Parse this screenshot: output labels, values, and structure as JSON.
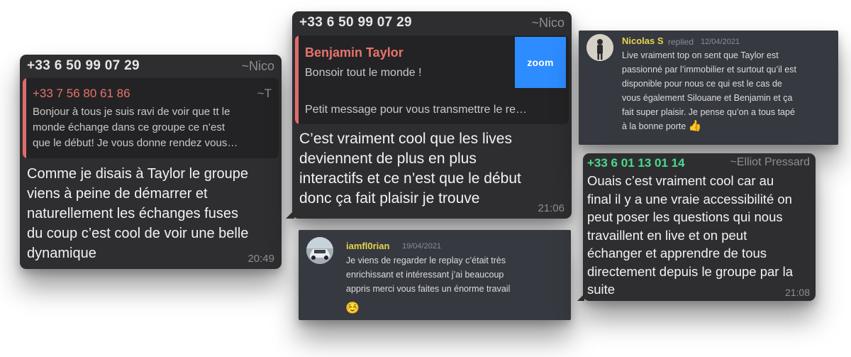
{
  "msg1": {
    "header_phone": "+33 6 50 99 07 29",
    "header_alias": "~Nico",
    "quote_phone": "+33 7 56 80 61 86",
    "quote_alias": "~T",
    "quote_lines": [
      "Bonjour à tous je suis ravi de voir que tt le",
      "monde échange dans ce groupe ce n’est",
      "que le début! Je vous donne rendez vous…"
    ],
    "body_lines": [
      "Comme je disais à Taylor le groupe",
      "viens à peine de démarrer et",
      "naturellement les échanges fuses",
      "du coup c’est cool de voir une belle",
      "dynamique"
    ],
    "time": "20:49"
  },
  "msg2": {
    "header_phone": "+33 6 50 99 07 29",
    "header_alias": "~Nico",
    "quote_name": "Benjamin Taylor",
    "quote_line1": "Bonsoir tout le monde !",
    "quote_line2": "Petit message pour vous transmettre le re…",
    "zoom_label": "zoom",
    "body_lines": [
      "C’est vraiment cool que les lives",
      "deviennent de plus en plus",
      "interactifs et ce n’est que le début",
      "donc ça fait plaisir je trouve"
    ],
    "time": "21:06"
  },
  "msg3": {
    "name": "Nicolas S",
    "action": "replied",
    "date": "12/04/2021",
    "lines": [
      "Live vraiment top on sent que Taylor est",
      "passionné par l’immobilier et surtout qu’il est",
      "disponible pour nous ce qui est le cas de",
      "vous également Silouane et Benjamin et ça",
      "fait super plaisir. Je pense qu’on a tous tapé",
      "à la bonne porte"
    ],
    "emoji": "👍"
  },
  "msg4": {
    "name": "iamfl0rian",
    "date": "19/04/2021",
    "lines": [
      "Je viens de regarder le replay c’était très",
      "enrichissant et intéressant j’ai beaucoup",
      "appris merci vous faites un énorme travail"
    ],
    "emoji": "☺️"
  },
  "msg5": {
    "header_phone": "+33 6 01 13 01 14",
    "header_alias": "~Elliot Pressard",
    "body_lines": [
      "Ouais c’est vraiment cool car au",
      "final il y a une vraie accessibilité on",
      "peut poser les questions qui nous",
      "travaillent en live et on peut",
      "échanger et apprendre de tous",
      "directement depuis le groupe par la",
      "suite"
    ],
    "time": "21:08"
  },
  "colors": {
    "bubble_bg": "#2e2e31",
    "discord_bg": "#36393f",
    "quote_accent": "#e06c6c",
    "whatsapp_green": "#4cd98a",
    "discord_name_yellow": "#e8d44d",
    "zoom_blue": "#2d8cff"
  }
}
